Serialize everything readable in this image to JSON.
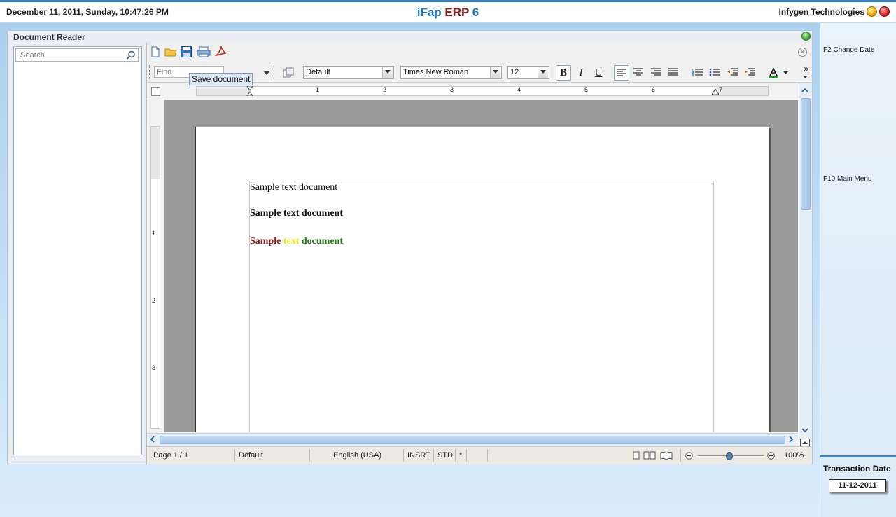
{
  "header": {
    "datetime": "December  11, 2011, Sunday, 10:47:26 PM",
    "app_title_part1": "iFap",
    "app_title_part2": "ERP",
    "app_title_part3": "6",
    "company": "Infygen Technologies"
  },
  "right_panel": {
    "f2": "F2 Change Date",
    "f10": "F10 Main Menu",
    "transaction_label": "Transaction Date",
    "transaction_date": "11-12-2011"
  },
  "window": {
    "title": "Document Reader",
    "search_placeholder": "Search"
  },
  "toolbar2": {
    "find_placeholder": "Find",
    "paragraph_style": "Default",
    "font_name": "Times New Roman",
    "font_size": "12",
    "bold": "B",
    "italic": "I",
    "underline": "U",
    "tooltip": "Save document"
  },
  "ruler": {
    "h_numbers": [
      "1",
      "2",
      "3",
      "4",
      "5",
      "6",
      "7"
    ],
    "v_numbers": [
      "1",
      "2",
      "3"
    ]
  },
  "document": {
    "line1": "Sample text document",
    "line2": "Sample text document",
    "line3_word1": "Sample",
    "line3_word2": "text",
    "line3_word3": "document"
  },
  "status": {
    "page": "Page 1 / 1",
    "style": "Default",
    "language": "English (USA)",
    "insert_mode": "INSRT",
    "selection_mode": "STD",
    "modified": "*",
    "zoom": "100%"
  },
  "colors": {
    "accent_blue": "#1b78c0",
    "title_red": "#8b1a1a",
    "doc_red": "#8b1a1a",
    "doc_yellow": "#f5e60a",
    "doc_green": "#1f7a12"
  }
}
